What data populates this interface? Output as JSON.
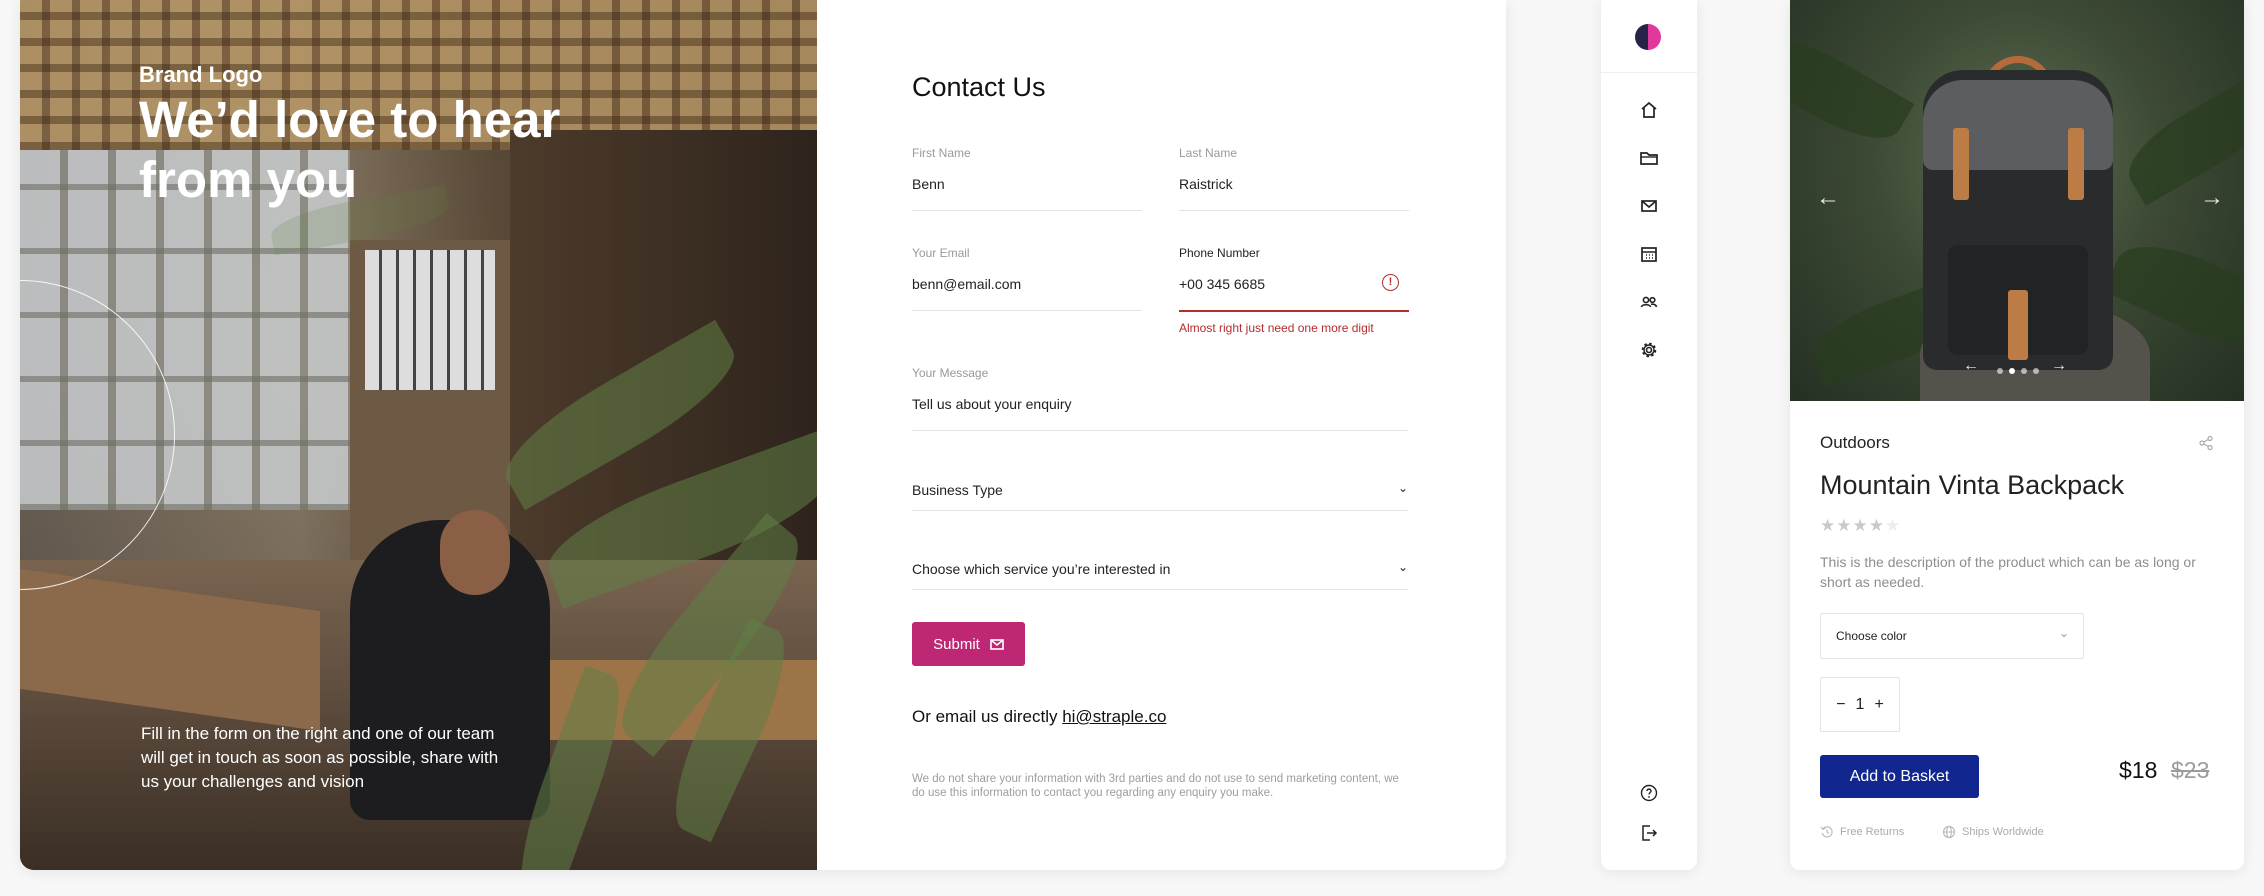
{
  "contact": {
    "hero": {
      "brand_logo": "Brand Logo",
      "title": "We’d love to hear from you",
      "copy": "Fill in the form on the right and one of our team will get in touch as soon as possible, share with us your challenges and vision"
    },
    "form": {
      "title": "Contact Us",
      "first_name": {
        "label": "First Name",
        "value": "Benn"
      },
      "last_name": {
        "label": "Last Name",
        "value": "Raistrick"
      },
      "email": {
        "label": "Your Email",
        "value": "benn@email.com"
      },
      "phone": {
        "label": "Phone Number",
        "value": "+00 345 6685",
        "error": "Almost right just need one more digit"
      },
      "message": {
        "label": "Your Message",
        "value": "Tell us about your enquiry"
      },
      "business_type": {
        "value": "Business Type"
      },
      "service": {
        "value": "Choose which service you’re interested in"
      },
      "submit_label": "Submit",
      "email_prefix": "Or email us directly ",
      "email_link": "hi@straple.co",
      "disclaimer": "We do not share your information with 3rd parties and do not use to send marketing content, we do use this information to contact you regarding any enquiry you make."
    },
    "colors": {
      "accent": "#bd2774",
      "error": "#b52c2c"
    }
  },
  "nav": {
    "logo_colors": [
      "#252446",
      "#e0399b"
    ],
    "items": [
      {
        "icon": "home-icon"
      },
      {
        "icon": "folder-icon"
      },
      {
        "icon": "mail-icon"
      },
      {
        "icon": "calendar-icon"
      },
      {
        "icon": "users-icon"
      },
      {
        "icon": "settings-icon"
      }
    ],
    "bottom_items": [
      {
        "icon": "help-icon"
      },
      {
        "icon": "logout-icon"
      }
    ]
  },
  "product": {
    "category": "Outdoors",
    "name": "Mountain Vinta Backpack",
    "rating": 4,
    "rating_max": 5,
    "description": "This is the description of the product which can be as long or short as needed.",
    "color_select": "Choose color",
    "quantity": "1",
    "qty_minus": "−",
    "qty_plus": "+",
    "add_label": "Add to Basket",
    "price": "$18",
    "old_price": "$23",
    "perks": [
      "Free Returns",
      "Ships Worldwide"
    ],
    "gallery": {
      "slides": 4,
      "active": 2
    },
    "colors": {
      "button": "#11278f"
    }
  }
}
